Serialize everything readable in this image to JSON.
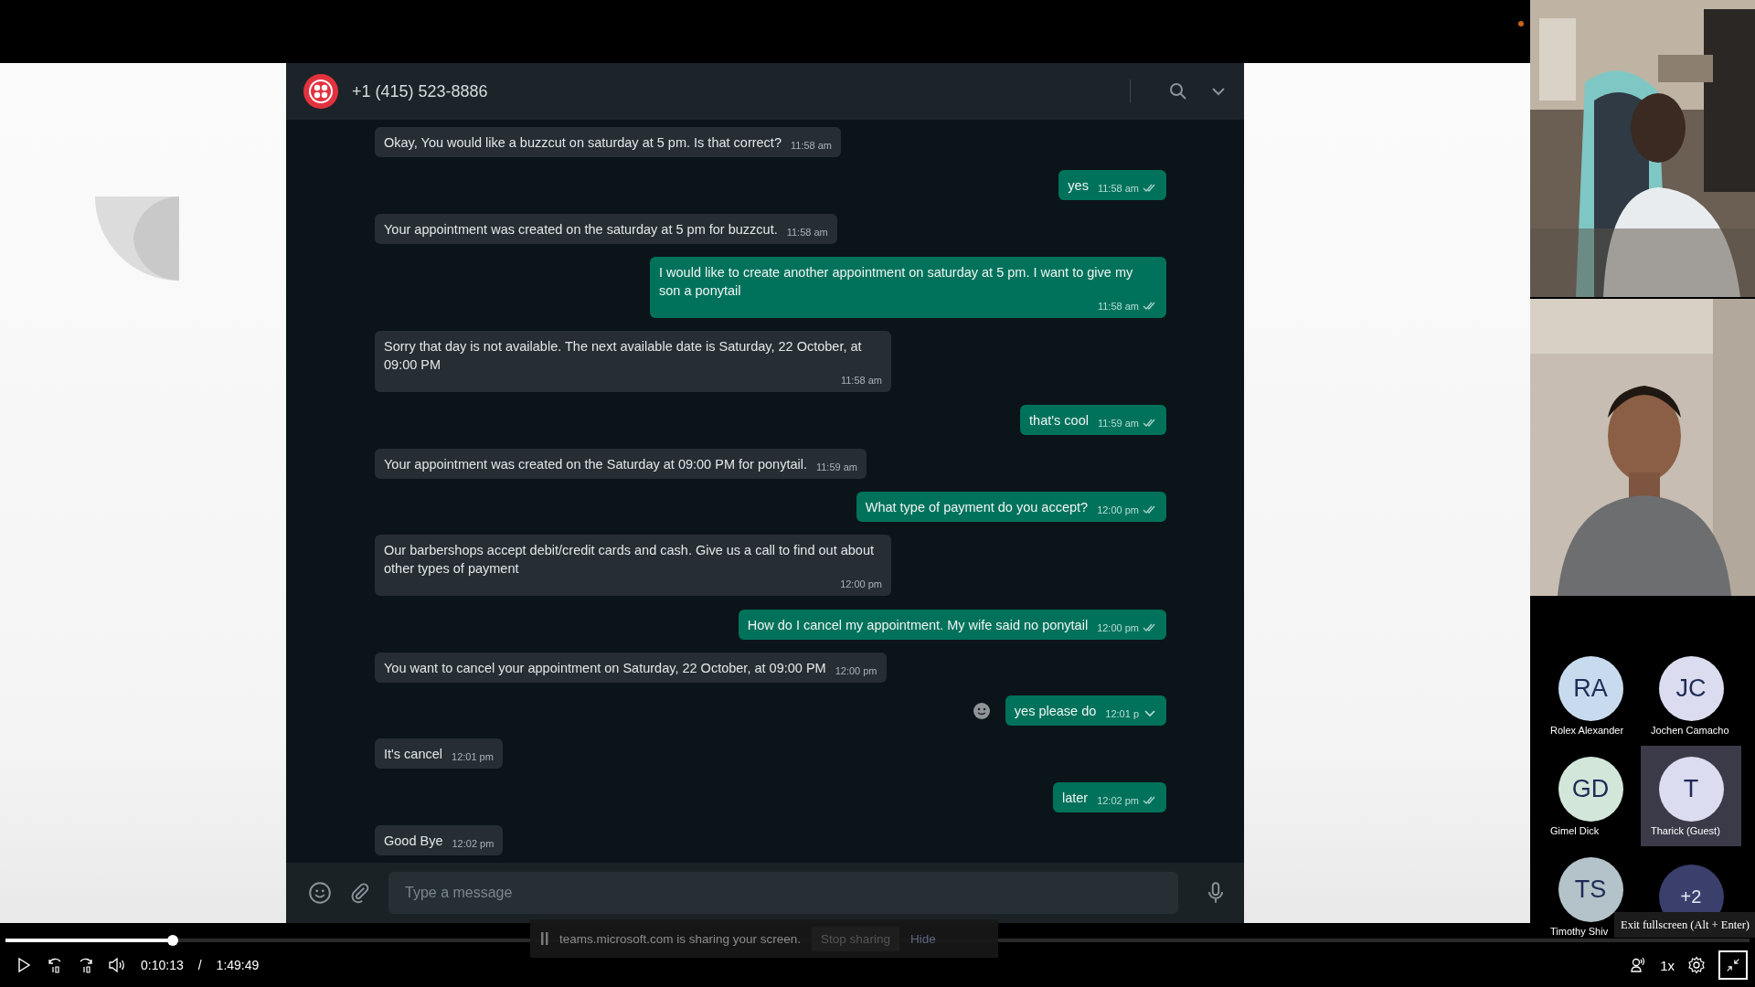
{
  "chat": {
    "phone": "+1 (415) 523-8886",
    "composer_placeholder": "Type a message"
  },
  "messages": [
    {
      "kind": "in",
      "text": "Okay, You would like a buzzcut on saturday at 5 pm. Is that correct?",
      "time": "11:58 am",
      "hovered": false
    },
    {
      "kind": "out",
      "text": "yes",
      "time": "11:58 am",
      "hovered": false
    },
    {
      "kind": "in",
      "text": "Your appointment was created on the saturday at 5 pm for buzzcut.",
      "time": "11:58 am",
      "hovered": false
    },
    {
      "kind": "out",
      "text": "I would like to create another appointment on saturday at 5 pm. I want to give my son a ponytail",
      "time": "11:58 am",
      "hovered": false
    },
    {
      "kind": "in",
      "text": "Sorry that day is not available. The next available date is Saturday, 22 October, at 09:00 PM",
      "time": "11:58 am",
      "hovered": false
    },
    {
      "kind": "out",
      "text": "that's cool",
      "time": "11:59 am",
      "hovered": false
    },
    {
      "kind": "in",
      "text": "Your appointment was created on the Saturday at 09:00 PM for ponytail.",
      "time": "11:59 am",
      "hovered": false
    },
    {
      "kind": "out",
      "text": "What type of payment do you accept?",
      "time": "12:00 pm",
      "hovered": false
    },
    {
      "kind": "in",
      "text": "Our barbershops accept debit/credit cards and cash. Give us a call to find out about other types of payment",
      "time": "12:00 pm",
      "hovered": false
    },
    {
      "kind": "out",
      "text": "How do I cancel my appointment. My wife said no ponytail",
      "time": "12:00 pm",
      "hovered": false
    },
    {
      "kind": "in",
      "text": "You want to cancel your appointment on Saturday, 22 October, at 09:00 PM",
      "time": "12:00 pm",
      "hovered": false
    },
    {
      "kind": "out",
      "text": "yes please do",
      "time": "12:01 p",
      "hovered": true
    },
    {
      "kind": "in",
      "text": "It's cancel",
      "time": "12:01 pm",
      "hovered": false
    },
    {
      "kind": "out",
      "text": "later",
      "time": "12:02 pm",
      "hovered": false
    },
    {
      "kind": "in",
      "text": "Good Bye",
      "time": "12:02 pm",
      "hovered": false
    }
  ],
  "participants": [
    {
      "kind": "person",
      "initials": "RA",
      "name": "Rolex Alexander",
      "color": "#c8dbee",
      "selected": false
    },
    {
      "kind": "person",
      "initials": "JC",
      "name": "Jochen Camacho",
      "color": "#dcdcf0",
      "selected": false
    },
    {
      "kind": "person",
      "initials": "GD",
      "name": "Gimel Dick",
      "color": "#d3e6da",
      "selected": false
    },
    {
      "kind": "person",
      "initials": "T",
      "name": "Tharick (Guest)",
      "color": "#dcdcf0",
      "selected": true
    },
    {
      "kind": "person",
      "initials": "TS",
      "name": "Timothy Shiv",
      "color": "#b4c2ca",
      "selected": false
    },
    {
      "kind": "more",
      "initials": "+2",
      "color": "#3a3f6c",
      "selected": false
    }
  ],
  "player": {
    "level": 0.096,
    "current_time": "0:10:13",
    "separator": "/",
    "duration": "1:49:49",
    "speed": "1x",
    "tooltip": "Exit fullscreen (Alt + Enter)"
  },
  "share_bar": {
    "text": "teams.microsoft.com is sharing your screen.",
    "stop": "Stop sharing",
    "hide": "Hide"
  }
}
